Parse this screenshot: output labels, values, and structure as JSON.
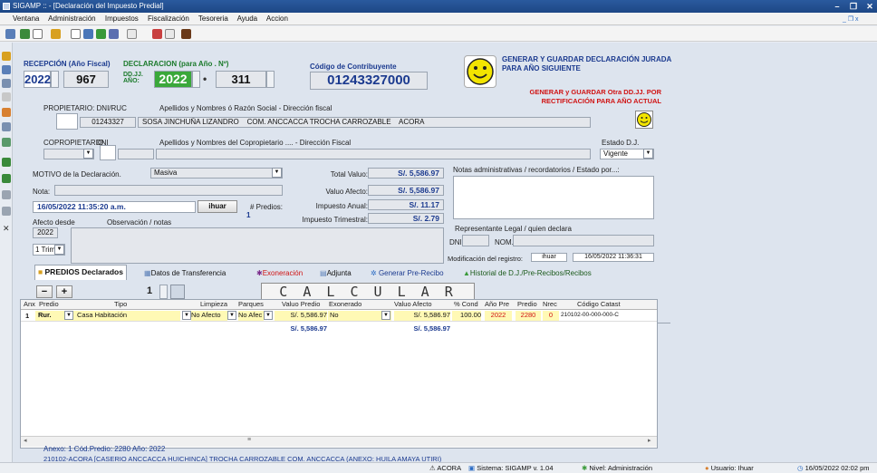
{
  "title": "SIGAMP :: - [Declaración del Impuesto Predial]",
  "window_buttons": [
    "–",
    "❐",
    "✕"
  ],
  "menu": [
    "Ventana",
    "Administración",
    "Impuestos",
    "Fiscalización",
    "Tesoreria",
    "Ayuda",
    "Accion"
  ],
  "mdi_buttons": "_ ❐ x",
  "reception": {
    "label": "RECEPCIÓN (Año Fiscal)",
    "year": "2022",
    "number": "967"
  },
  "declaration": {
    "label": "DECLARACION (para Año . Nº)",
    "dj_label": "DD.JJ. AÑO:",
    "year": "2022",
    "dot": "•",
    "number": "311"
  },
  "contributor": {
    "label": "Código de Contribuyente",
    "code": "01243327000"
  },
  "generate1": "GENERAR Y GUARDAR DECLARACIÓN JURADA PARA AÑO SIGUIENTE",
  "generate2": "GENERAR y GUARDAR Otra DD.JJ. POR RECTIFICACIÓN PARA AÑO ACTUAL",
  "owner": {
    "label": "PROPIETARIO: DNI/RUC",
    "names_label": "Apellidos y Nombres ó Razón Social - Dirección fiscal",
    "dni": "01243327",
    "name": "SOSA JINCHUÑA LIZANDRO",
    "address": "COM. ANCCACCA TROCHA CARROZABLE",
    "district": "ACORA"
  },
  "coowner": {
    "label": "COPROPIETARIO",
    "dni_label": "DNI",
    "names_label": "Apellidos y Nombres del Copropietario .... - Dirección Fiscal"
  },
  "estado": {
    "label": "Estado D.J.",
    "value": "Vigente"
  },
  "motivo": {
    "label": "MOTIVO de la Declaración.",
    "value": "Masiva"
  },
  "nota_label": "Nota:",
  "datetime": "16/05/2022 11:35:20 a.m.",
  "user_button": "ihuar",
  "predios": {
    "label": "# Predios:",
    "value": "1"
  },
  "totals": [
    {
      "label": "Total Valuo:",
      "value": "S/. 5,586.97"
    },
    {
      "label": "Valuo Afecto:",
      "value": "S/. 5,586.97"
    },
    {
      "label": "Impuesto Anual:",
      "value": "S/. 11.17"
    },
    {
      "label": "Impuesto Trimestral:",
      "value": "S/. 2.79"
    }
  ],
  "notes_label": "Notas administrativas / recordatorios / Estado por...:",
  "afecto_label": "Afecto desde",
  "obs_label": "Observación / notas",
  "afecto_year": "2022",
  "trim": "1 Trim.",
  "rep": {
    "label": "Representante Legal / quien declara",
    "dni_label": "DNI",
    "nom_label": "NOM."
  },
  "modification": {
    "label": "Modificación del registro:",
    "user": "ihuar",
    "date": "16/05/2022 11:36:31"
  },
  "tabs": [
    "PREDIOS Declarados",
    "Datos de Transferencia",
    "Exoneración",
    "Adjunta",
    "Generar Pre-Recibo",
    "Historial de D.J./Pre-Recibos/Recibos"
  ],
  "grid_toolbar": {
    "minus": "−",
    "plus": "+",
    "count": "1",
    "calcular": "C A L C U L A R"
  },
  "columns": [
    "Anx",
    "Predio",
    "Tipo",
    "Limpieza",
    "Parques",
    "Valuo Predio",
    "Exonerado",
    "Valuo Afecto",
    "% Cond",
    "Año Pre",
    "Predio",
    "Nrec",
    "Código Catast"
  ],
  "row": {
    "anx": "1",
    "predio": "Rur.",
    "tipo": "Casa Habitación",
    "limpieza": "No Afecto",
    "parques": "No Afec",
    "valuo": "S/. 5,586.97",
    "exonerado": "No",
    "afecto": "S/. 5,586.97",
    "cond": "100.00",
    "anio": "2022",
    "predio_n": "2280",
    "nrec": "0",
    "catastro": "210102-00-000-000-C"
  },
  "totals_row": {
    "valuo": "S/. 5,586.97",
    "afecto": "S/. 5,586.97"
  },
  "info": {
    "line1": "Anexo: 1     Cód.Predio: 2280  Año: 2022",
    "line2": "210102-ACORA   [CASERIO ANCCACCA HUICHINCA]  TROCHA CARROZABLE  COM. ANCCACCA  (ANEXO: HUILA AMAYA UTIRI)"
  },
  "status": {
    "place": "ACORA",
    "system": "Sistema: SIGAMP v. 1.04",
    "level": "Nivel: Administración",
    "user": "Usuario: Ihuar",
    "datetime": "16/05/2022 02:02 pm"
  },
  "colors": {
    "title": "#1d4785",
    "accent_blue": "#1b3a8f",
    "red": "#d01212",
    "smiley": "#f2e400"
  }
}
